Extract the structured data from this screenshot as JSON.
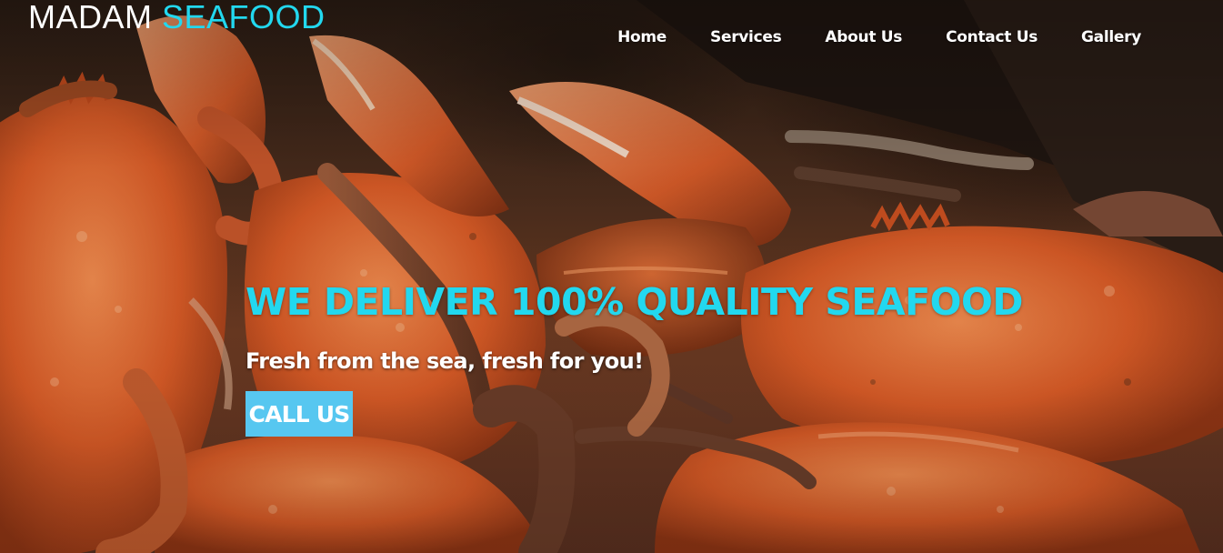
{
  "brand": {
    "word1": "MADAM",
    "word2": "SEAFOOD"
  },
  "nav": {
    "items": [
      "Home",
      "Services",
      "About Us",
      "Contact Us",
      "Gallery"
    ]
  },
  "hero": {
    "headline": "WE DELIVER 100% QUALITY SEAFOOD",
    "subline": "Fresh from the sea, fresh for you!",
    "cta_label": "CALL US",
    "image_subject": "pile of steamed orange crabs"
  },
  "colors": {
    "accent": "#22d8ef",
    "cta_bg": "#57c7f0",
    "nav_text": "#ffffff",
    "crab_orange": "#d9622e"
  }
}
